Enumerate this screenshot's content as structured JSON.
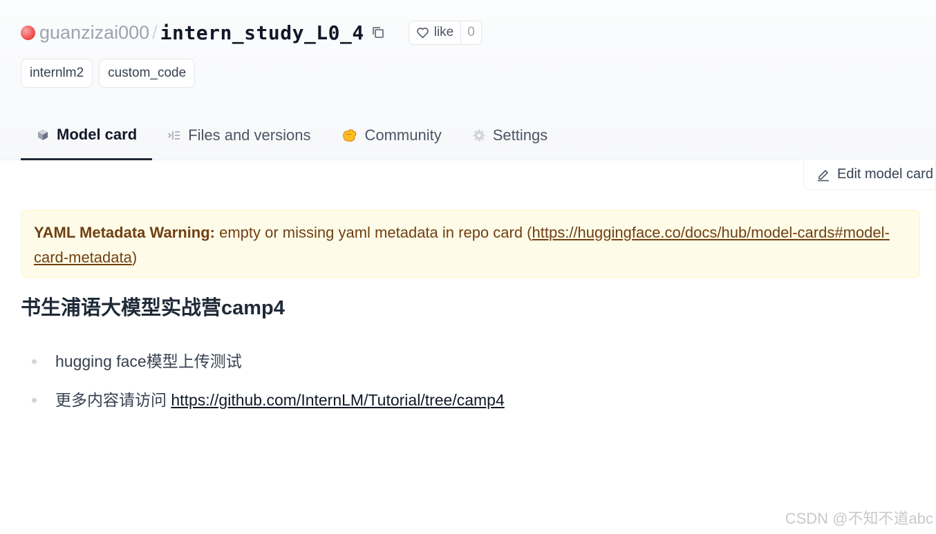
{
  "repo": {
    "owner": "guanzizai000",
    "separator": "/",
    "name": "intern_study_L0_4",
    "like_label": "like",
    "like_count": "0"
  },
  "tags": [
    "internlm2",
    "custom_code"
  ],
  "tabs": [
    {
      "label": "Model card",
      "icon": "cube-icon",
      "active": true
    },
    {
      "label": "Files and versions",
      "icon": "files-icon",
      "active": false
    },
    {
      "label": "Community",
      "icon": "community-icon",
      "active": false
    },
    {
      "label": "Settings",
      "icon": "gear-icon",
      "active": false
    }
  ],
  "edit_button": {
    "label": "Edit model card",
    "icon": "pencil-icon"
  },
  "warning": {
    "label": "YAML Metadata Warning:",
    "text": " empty or missing yaml metadata in repo card (",
    "link": "https://huggingface.co/docs/hub/model-cards#model-card-metadata",
    "closing": ")"
  },
  "content": {
    "heading": "书生浦语大模型实战营camp4",
    "items": [
      {
        "text": "hugging face模型上传测试",
        "link": ""
      },
      {
        "text": "更多内容请访问 ",
        "link": "https://github.com/InternLM/Tutorial/tree/camp4"
      }
    ]
  },
  "watermark": "CSDN @不知不道abc",
  "colors": {
    "accent": "#1f2937",
    "warning_bg": "#fefce8",
    "warning_text": "#713f12"
  }
}
